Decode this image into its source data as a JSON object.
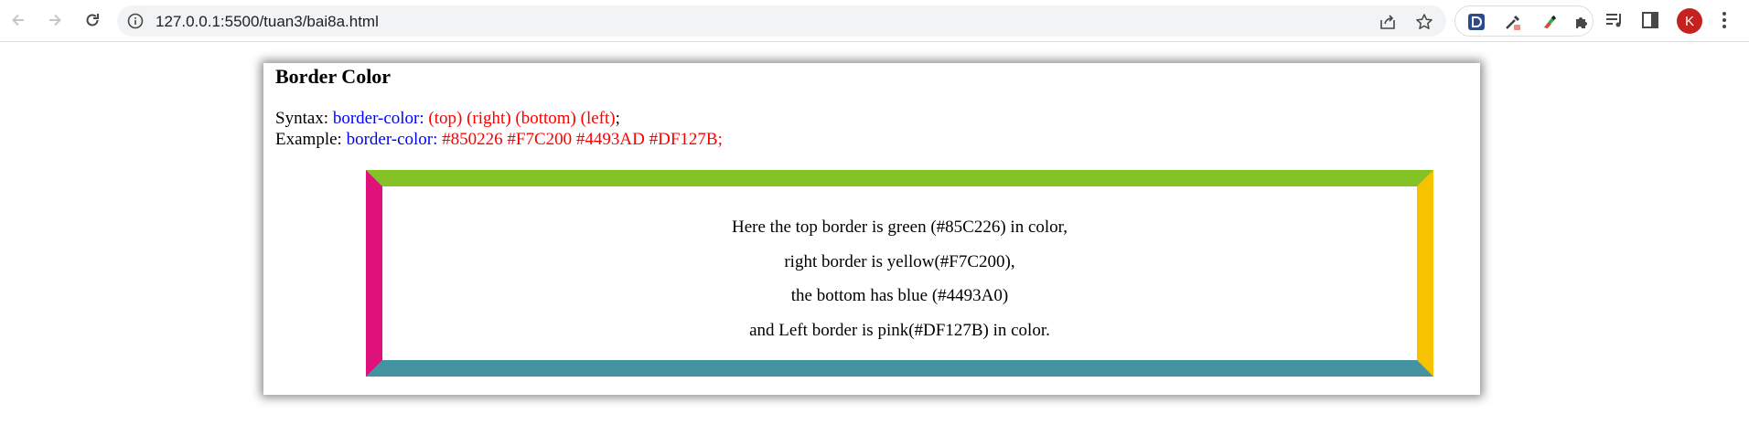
{
  "browser": {
    "url": "127.0.0.1:5500/tuan3/bai8a.html",
    "profile_initial": "K",
    "icons": {
      "back": "arrow-left-icon",
      "forward": "arrow-right-icon",
      "reload": "reload-icon",
      "site_info": "info-icon",
      "share": "share-icon",
      "bookmark": "star-icon",
      "extensions": [
        "d-extension-icon",
        "eyedropper-extension-icon",
        "color-extension-icon",
        "puzzle-icon"
      ],
      "media": "media-playlist-icon",
      "side_panel": "side-panel-icon",
      "menu": "kebab-menu-icon"
    }
  },
  "page": {
    "title": "Border Color",
    "syntax": {
      "label": "Syntax:",
      "property": "border-color:",
      "values": "(top) (right) (bottom) (left)",
      "terminator": ";"
    },
    "example": {
      "label": "Example:",
      "property": "border-color:",
      "values": "#850226 #F7C200 #4493AD #DF127B;"
    },
    "demo": {
      "border_colors": {
        "top": "#85C226",
        "right": "#F7C200",
        "bottom": "#4493A0",
        "left": "#DF127B"
      },
      "lines": [
        "Here the top border is green (#85C226) in color,",
        "right border is yellow(#F7C200),",
        "the bottom has blue (#4493A0)",
        "and Left border is pink(#DF127B) in color."
      ]
    }
  }
}
